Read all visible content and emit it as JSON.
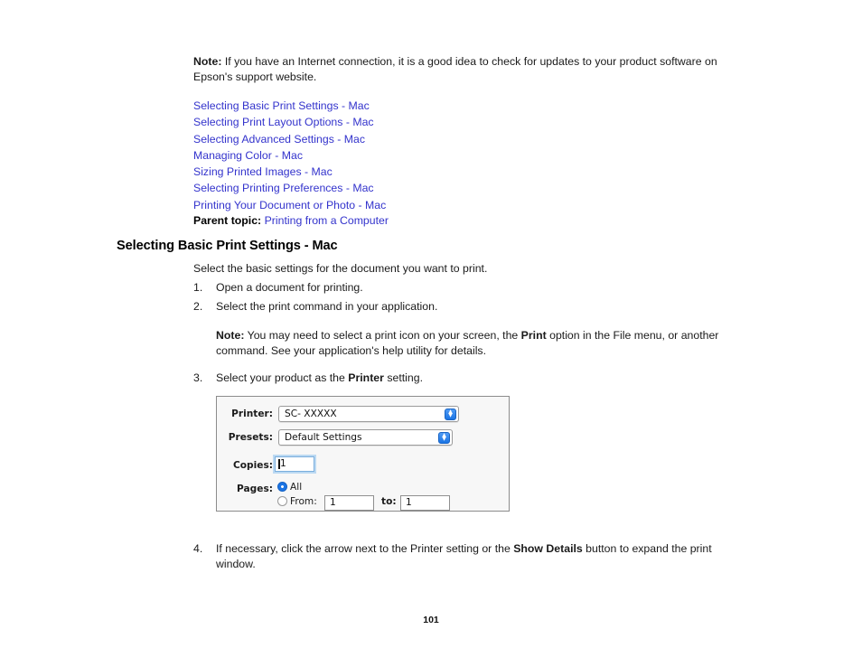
{
  "note_intro": {
    "label": "Note:",
    "text": " If you have an Internet connection, it is a good idea to check for updates to your product software on Epson's support website."
  },
  "links": [
    {
      "label": "Selecting Basic Print Settings - Mac"
    },
    {
      "label": "Selecting Print Layout Options - Mac"
    },
    {
      "label": "Selecting Advanced Settings - Mac"
    },
    {
      "label": "Managing Color - Mac"
    },
    {
      "label": "Sizing Printed Images - Mac"
    },
    {
      "label": "Selecting Printing Preferences - Mac"
    },
    {
      "label": "Printing Your Document or Photo - Mac"
    }
  ],
  "parent_topic": {
    "label": "Parent topic:",
    "link": "Printing from a Computer"
  },
  "heading": "Selecting Basic Print Settings - Mac",
  "intro": "Select the basic settings for the document you want to print.",
  "steps": {
    "one": {
      "num": "1.",
      "text": "Open a document for printing."
    },
    "two": {
      "num": "2.",
      "text": "Select the print command in your application."
    },
    "three": {
      "num": "3.",
      "text_before": "Select your product as the ",
      "bold": "Printer",
      "text_after": " setting."
    },
    "four": {
      "num": "4.",
      "text_before": "If necessary, click the arrow next to the Printer setting or the ",
      "bold": "Show Details",
      "text_after": " button to expand the print window."
    }
  },
  "step_note": {
    "label": "Note:",
    "text_before": " You may need to select a print icon on your screen, the ",
    "bold": "Print",
    "text_after": " option in the File menu, or another command. See your application's help utility for details."
  },
  "print_dialog": {
    "printer": {
      "label": "Printer:",
      "value": "SC- XXXXX"
    },
    "presets": {
      "label": "Presets:",
      "value": "Default Settings"
    },
    "copies": {
      "label": "Copies:",
      "value": "1"
    },
    "pages": {
      "label": "Pages:",
      "all_option": "All",
      "from_option": "From:",
      "from_value": "1",
      "to_label": "to:",
      "to_value": "1",
      "selected": "All"
    }
  },
  "footer": {
    "page_number": "101"
  },
  "colors": {
    "link": "#3333cc",
    "text": "#1a1a1a",
    "accent_blue": "#1b74e4",
    "dialog_border": "#8c8c8c"
  }
}
